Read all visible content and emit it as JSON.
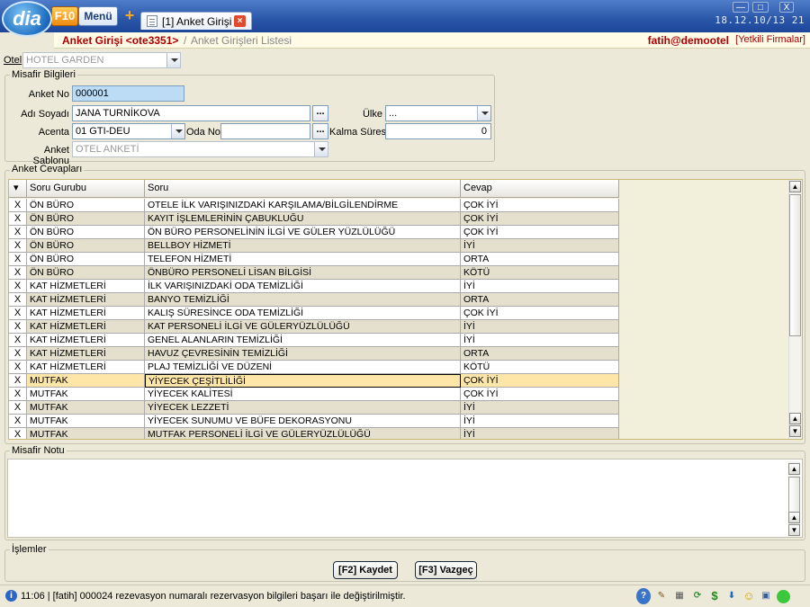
{
  "app": {
    "logo_text": "dia",
    "f10_label": "F10",
    "menu_label": "Menü",
    "tab_label": "[1] Anket Girişi",
    "clock": "18.12.10/13 21",
    "win_min": "—",
    "win_max": "□",
    "win_close": "X"
  },
  "breadcrumb": {
    "main": "Anket Girişi <ote3351>",
    "sep": "/",
    "sub": "Anket Girişleri Listesi",
    "user": "fatih@demootel",
    "firms": "[Yetkili Firmalar]"
  },
  "form": {
    "otel_label": "Otel",
    "otel_value": "HOTEL GARDEN",
    "misafir_title": "Misafir Bilgileri",
    "anket_no_label": "Anket No",
    "anket_no_value": "000001",
    "adi_soyadi_label": "Adı Soyadı",
    "adi_soyadi_value": "JANA TURNİKOVA",
    "ulke_label": "Ülke",
    "ulke_value": "...",
    "acenta_label": "Acenta",
    "acenta_value": "01 GTI-DEU",
    "oda_no_label": "Oda No",
    "oda_no_value": "",
    "kalma_label": "Kalma Süresi",
    "kalma_value": "0",
    "sablon_label": "Anket Şablonu",
    "sablon_value": "OTEL ANKETİ",
    "ellipsis": "..."
  },
  "answers": {
    "title": "Anket Cevapları",
    "columns": {
      "sort": "▾",
      "group": "Soru Gurubu",
      "question": "Soru",
      "answer": "Cevap"
    },
    "delete_label": "X",
    "rows": [
      [
        "ÖN BÜRO",
        "OTELE İLK VARIŞINIZDAKİ KARŞILAMA/BİLGİLENDİRME",
        "ÇOK İYİ"
      ],
      [
        "ÖN BÜRO",
        "KAYIT İŞLEMLERİNİN ÇABUKLUĞU",
        "ÇOK İYİ"
      ],
      [
        "ÖN BÜRO",
        "ÖN BÜRO PERSONELİNİN İLGİ VE GÜLER YÜZLÜLÜĞÜ",
        "ÇOK İYİ"
      ],
      [
        "ÖN BÜRO",
        "BELLBOY HİZMETİ",
        "İYİ"
      ],
      [
        "ÖN BÜRO",
        "TELEFON HİZMETİ",
        "ORTA"
      ],
      [
        "ÖN BÜRO",
        "ÖNBÜRO PERSONELİ LİSAN BİLGİSİ",
        "KÖTÜ"
      ],
      [
        "KAT HİZMETLERİ",
        "İLK VARIŞINIZDAKİ ODA TEMİZLİĞİ",
        "İYİ"
      ],
      [
        "KAT HİZMETLERİ",
        "BANYO TEMİZLİĞİ",
        "ORTA"
      ],
      [
        "KAT HİZMETLERİ",
        "KALIŞ SÜRESİNCE ODA TEMİZLİĞİ",
        "ÇOK İYİ"
      ],
      [
        "KAT HİZMETLERİ",
        "KAT PERSONELİ İLGİ VE GÜLERYÜZLÜLÜĞÜ",
        "İYİ"
      ],
      [
        "KAT HİZMETLERİ",
        "GENEL ALANLARIN TEMİZLİĞİ",
        "İYİ"
      ],
      [
        "KAT HİZMETLERİ",
        "HAVUZ ÇEVRESİNİN TEMİZLİĞİ",
        "ORTA"
      ],
      [
        "KAT HİZMETLERİ",
        "PLAJ TEMİZLİĞİ VE DÜZENİ",
        "KÖTÜ"
      ],
      [
        "MUTFAK",
        "YİYECEK ÇEŞİTLİLİĞİ",
        "ÇOK İYİ"
      ],
      [
        "MUTFAK",
        "YİYECEK KALİTESİ",
        "ÇOK İYİ"
      ],
      [
        "MUTFAK",
        "YİYECEK LEZZETİ",
        "İYİ"
      ],
      [
        "MUTFAK",
        "YİYECEK SUNUMU VE BÜFE DEKORASYONU",
        "İYİ"
      ],
      [
        "MUTFAK",
        "MUTFAK PERSONELİ İLGİ VE GÜLERYÜZLÜLÜĞÜ",
        "İYİ"
      ]
    ],
    "selected_row": 13
  },
  "note": {
    "title": "Misafir Notu"
  },
  "actions": {
    "title": "İşlemler",
    "save": "[F2] Kaydet",
    "cancel": "[F3] Vazgeç"
  },
  "status": {
    "text": "11:06 | [fatih] 000024 rezevasyon numaralı rezervasyon bilgileri başarı ile değiştirilmiştir."
  },
  "colors": {
    "titlebar": "#2a56a8",
    "breadcrumb_text": "#aa0000",
    "selected_row": "#fde6a8",
    "row_alt": "#e4e0cd"
  }
}
